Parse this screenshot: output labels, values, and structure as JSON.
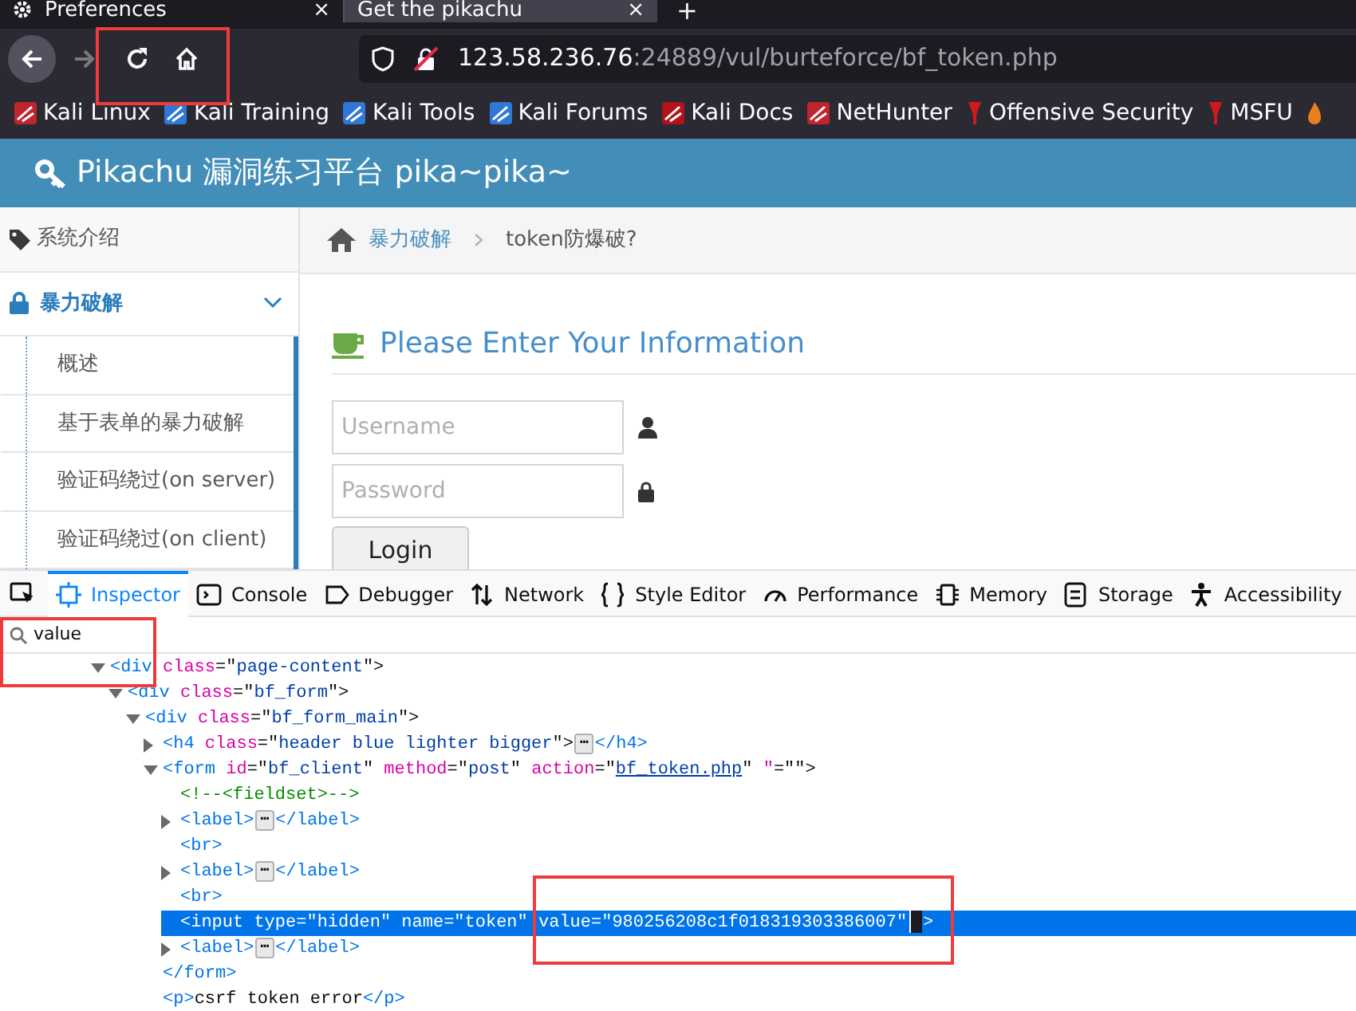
{
  "browser": {
    "tabs": [
      {
        "label": "Preferences",
        "selected": false,
        "close": "×"
      },
      {
        "label": "Get the pikachu",
        "selected": true,
        "close": "×"
      }
    ],
    "new_tab": "+",
    "url": {
      "host": "123.58.236.76",
      "path": ":24889/vul/burteforce/bf_token.php"
    },
    "bookmarks": [
      "Kali Linux",
      "Kali Training",
      "Kali Tools",
      "Kali Forums",
      "Kali Docs",
      "NetHunter",
      "Offensive Security",
      "MSFU"
    ]
  },
  "site": {
    "title": "Pikachu 漏洞练习平台 pika~pika~",
    "sidebar": [
      {
        "label": "系统介绍",
        "expanded": false,
        "selected": false
      },
      {
        "label": "暴力破解",
        "expanded": true,
        "selected": true,
        "children": [
          "概述",
          "基于表单的暴力破解",
          "验证码绕过(on server)",
          "验证码绕过(on client)"
        ]
      }
    ],
    "breadcrumb": [
      "暴力破解",
      "token防爆破?"
    ],
    "form": {
      "heading": "Please Enter Your Information",
      "fields": [
        {
          "placeholder": "Username",
          "kind": "user"
        },
        {
          "placeholder": "Password",
          "kind": "password"
        }
      ],
      "button": "Login"
    }
  },
  "devtools": {
    "tabs": [
      {
        "label": "Inspector",
        "selected": true
      },
      {
        "label": "Console",
        "selected": false
      },
      {
        "label": "Debugger",
        "selected": false
      },
      {
        "label": "Network",
        "selected": false
      },
      {
        "label": "Style Editor",
        "selected": false
      },
      {
        "label": "Performance",
        "selected": false
      },
      {
        "label": "Memory",
        "selected": false
      },
      {
        "label": "Storage",
        "selected": false
      },
      {
        "label": "Accessibility",
        "selected": false
      }
    ],
    "search": {
      "value": "value"
    },
    "tree": [
      {
        "expanded": true,
        "selected": false,
        "tokens": [
          {
            "kind": "tag",
            "text": "<div"
          },
          {
            "kind": "attr",
            "text": " class"
          },
          {
            "kind": "punct",
            "text": "=\""
          },
          {
            "kind": "value",
            "text": "page-content"
          },
          {
            "kind": "punct",
            "text": "\">"
          }
        ],
        "children": [
          {
            "expanded": true,
            "selected": false,
            "tokens": [
              {
                "kind": "tag",
                "text": "<div"
              },
              {
                "kind": "attr",
                "text": " class"
              },
              {
                "kind": "punct",
                "text": "=\""
              },
              {
                "kind": "value",
                "text": "bf_form"
              },
              {
                "kind": "punct",
                "text": "\">"
              }
            ],
            "children": [
              {
                "expanded": true,
                "selected": false,
                "tokens": [
                  {
                    "kind": "tag",
                    "text": "<div"
                  },
                  {
                    "kind": "attr",
                    "text": " class"
                  },
                  {
                    "kind": "punct",
                    "text": "=\""
                  },
                  {
                    "kind": "value",
                    "text": "bf_form_main"
                  },
                  {
                    "kind": "punct",
                    "text": "\">"
                  }
                ],
                "children": [
                  {
                    "expanded": false,
                    "selected": false,
                    "tokens": [
                      {
                        "kind": "tag",
                        "text": "<h4"
                      },
                      {
                        "kind": "attr",
                        "text": " class"
                      },
                      {
                        "kind": "punct",
                        "text": "=\""
                      },
                      {
                        "kind": "value",
                        "text": "header blue lighter bigger"
                      },
                      {
                        "kind": "punct",
                        "text": "\">"
                      },
                      {
                        "kind": "badge",
                        "text": "⋯"
                      },
                      {
                        "kind": "tag",
                        "text": "</h4>"
                      }
                    ]
                  },
                  {
                    "expanded": true,
                    "selected": false,
                    "tokens": [
                      {
                        "kind": "tag",
                        "text": "<form"
                      },
                      {
                        "kind": "attr",
                        "text": " id"
                      },
                      {
                        "kind": "punct",
                        "text": "=\""
                      },
                      {
                        "kind": "value",
                        "text": "bf_client"
                      },
                      {
                        "kind": "punct",
                        "text": "\""
                      },
                      {
                        "kind": "attr",
                        "text": " method"
                      },
                      {
                        "kind": "punct",
                        "text": "=\""
                      },
                      {
                        "kind": "value",
                        "text": "post"
                      },
                      {
                        "kind": "punct",
                        "text": "\""
                      },
                      {
                        "kind": "attr",
                        "text": " action"
                      },
                      {
                        "kind": "punct",
                        "text": "=\""
                      },
                      {
                        "kind": "link",
                        "text": "bf_token.php"
                      },
                      {
                        "kind": "punct",
                        "text": "\""
                      },
                      {
                        "kind": "attr",
                        "text": " \""
                      },
                      {
                        "kind": "punct",
                        "text": "=\"\">"
                      }
                    ],
                    "children": [
                      {
                        "selected": false,
                        "tokens": [
                          {
                            "kind": "comment",
                            "text": "<!--<fieldset>-->"
                          }
                        ]
                      },
                      {
                        "expanded": false,
                        "selected": false,
                        "tokens": [
                          {
                            "kind": "tag",
                            "text": "<label>"
                          },
                          {
                            "kind": "badge",
                            "text": "⋯"
                          },
                          {
                            "kind": "tag",
                            "text": "</label>"
                          }
                        ]
                      },
                      {
                        "selected": false,
                        "tokens": [
                          {
                            "kind": "tag",
                            "text": "<br>"
                          }
                        ]
                      },
                      {
                        "expanded": false,
                        "selected": false,
                        "tokens": [
                          {
                            "kind": "tag",
                            "text": "<label>"
                          },
                          {
                            "kind": "badge",
                            "text": "⋯"
                          },
                          {
                            "kind": "tag",
                            "text": "</label>"
                          }
                        ]
                      },
                      {
                        "selected": false,
                        "tokens": [
                          {
                            "kind": "tag",
                            "text": "<br>"
                          }
                        ]
                      },
                      {
                        "selected": true,
                        "cursor": true,
                        "tokens": [
                          {
                            "kind": "tag",
                            "text": "<input"
                          },
                          {
                            "kind": "attr",
                            "text": " type"
                          },
                          {
                            "kind": "punct",
                            "text": "=\""
                          },
                          {
                            "kind": "value",
                            "text": "hidden"
                          },
                          {
                            "kind": "punct",
                            "text": "\""
                          },
                          {
                            "kind": "attr",
                            "text": " name"
                          },
                          {
                            "kind": "punct",
                            "text": "=\""
                          },
                          {
                            "kind": "value",
                            "text": "token"
                          },
                          {
                            "kind": "punct",
                            "text": "\""
                          },
                          {
                            "kind": "attr",
                            "text": " value"
                          },
                          {
                            "kind": "punct",
                            "text": "=\""
                          },
                          {
                            "kind": "value",
                            "text": "980256208c1f018319303386007"
                          },
                          {
                            "kind": "punct",
                            "text": "\""
                          },
                          {
                            "kind": "punct",
                            "text": ">"
                          }
                        ]
                      },
                      {
                        "expanded": false,
                        "selected": false,
                        "tokens": [
                          {
                            "kind": "tag",
                            "text": "<label>"
                          },
                          {
                            "kind": "badge",
                            "text": "⋯"
                          },
                          {
                            "kind": "tag",
                            "text": "</label>"
                          }
                        ]
                      }
                    ],
                    "closing": [
                      {
                        "kind": "tag",
                        "text": "</form>"
                      }
                    ]
                  },
                  {
                    "selected": false,
                    "tokens": [
                      {
                        "kind": "tag",
                        "text": "<p>"
                      },
                      {
                        "kind": "text",
                        "text": "csrf token error"
                      },
                      {
                        "kind": "tag",
                        "text": "</p>"
                      }
                    ]
                  }
                ]
              }
            ]
          }
        ]
      }
    ]
  }
}
